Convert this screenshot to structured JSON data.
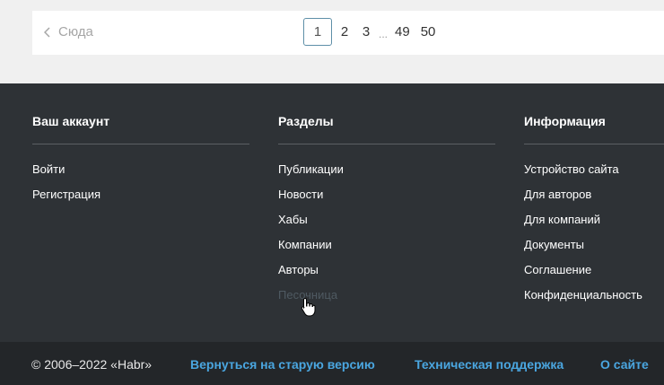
{
  "pagination": {
    "prev_label": "Сюда",
    "pages": [
      "1",
      "2",
      "3",
      "49",
      "50"
    ],
    "ellipsis": "...",
    "current": "1"
  },
  "footer": {
    "columns": [
      {
        "title": "Ваш аккаунт",
        "items": [
          "Войти",
          "Регистрация"
        ]
      },
      {
        "title": "Разделы",
        "items": [
          "Публикации",
          "Новости",
          "Хабы",
          "Компании",
          "Авторы",
          "Песочница"
        ]
      },
      {
        "title": "Информация",
        "items": [
          "Устройство сайта",
          "Для авторов",
          "Для компаний",
          "Документы",
          "Соглашение",
          "Конфиденциальность"
        ]
      }
    ]
  },
  "bottom": {
    "copyright": "© 2006–2022 «Habr»",
    "old_version": "Вернуться на старую версию",
    "support": "Техническая поддержка",
    "about": "О сайте"
  },
  "colors": {
    "link": "#4aa6e0",
    "footer": "#2e3236",
    "bottom_bar": "#232629"
  }
}
